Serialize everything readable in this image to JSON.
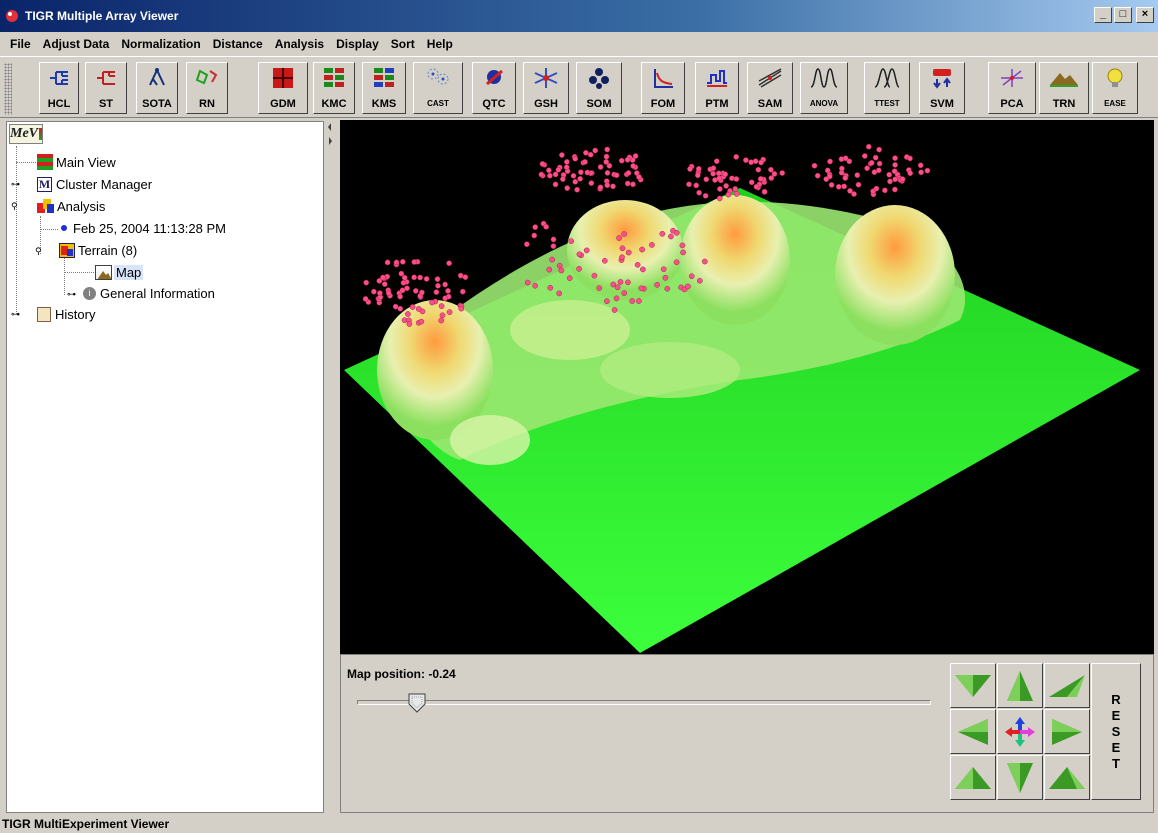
{
  "window": {
    "title": "TIGR Multiple Array Viewer"
  },
  "menu": [
    "File",
    "Adjust Data",
    "Normalization",
    "Distance",
    "Analysis",
    "Display",
    "Sort",
    "Help"
  ],
  "toolbar": [
    {
      "label": "HCL",
      "icon": "hierarchical-tree-icon"
    },
    {
      "label": "ST",
      "icon": "support-tree-icon"
    },
    {
      "label": "SOTA",
      "icon": "sota-tree-icon"
    },
    {
      "label": "RN",
      "icon": "relevance-network-icon"
    },
    {
      "label": "GDM",
      "icon": "gene-distance-matrix-icon"
    },
    {
      "label": "KMC",
      "icon": "kmeans-cluster-icon"
    },
    {
      "label": "KMS",
      "icon": "kmeans-support-icon"
    },
    {
      "label": "CAST",
      "icon": "cast-icon"
    },
    {
      "label": "QTC",
      "icon": "qt-cluster-icon"
    },
    {
      "label": "GSH",
      "icon": "gene-shaving-icon"
    },
    {
      "label": "SOM",
      "icon": "som-icon"
    },
    {
      "label": "FOM",
      "icon": "figure-of-merit-icon"
    },
    {
      "label": "PTM",
      "icon": "template-matching-icon"
    },
    {
      "label": "SAM",
      "icon": "sam-icon"
    },
    {
      "label": "ANOVA",
      "icon": "anova-icon"
    },
    {
      "label": "TTEST",
      "icon": "ttest-icon"
    },
    {
      "label": "SVM",
      "icon": "svm-icon"
    },
    {
      "label": "PCA",
      "icon": "pca-icon"
    },
    {
      "label": "TRN",
      "icon": "terrain-icon"
    },
    {
      "label": "EASE",
      "icon": "ease-lightbulb-icon"
    }
  ],
  "tree": {
    "logo": "MeV",
    "main_view": "Main View",
    "cluster_manager": "Cluster Manager",
    "analysis": "Analysis",
    "timestamp": "Feb 25, 2004 11:13:28 PM",
    "terrain": "Terrain (8)",
    "map": "Map",
    "general_info": "General Information",
    "history": "History"
  },
  "controls": {
    "map_position_label": "Map position: -0.24",
    "map_position_value": -0.24,
    "reset_label": [
      "R",
      "E",
      "S",
      "E",
      "T"
    ]
  },
  "status": "TIGR MultiExperiment Viewer",
  "colors": {
    "terrain_base": "#33ff33",
    "peak": "#e87a3c",
    "points": "#ff4f8b",
    "nav_arrow": "#3a9a24"
  }
}
